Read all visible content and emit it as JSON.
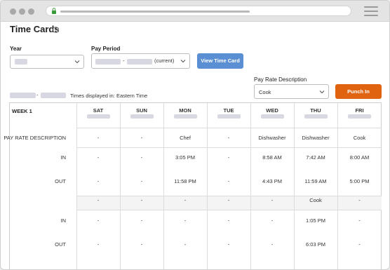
{
  "page": {
    "title": "Time Cards"
  },
  "filters": {
    "year_label": "Year",
    "pay_period_label": "Pay Period",
    "pay_period_sep": "-",
    "pay_period_suffix": "(current)",
    "view_button": "View Time Card",
    "pay_rate_label": "Pay Rate Description",
    "pay_rate_value": "Cook",
    "punch_button": "Punch In",
    "range_sep": "-",
    "timezone_text": "Times displayed in: Eastern Time"
  },
  "table": {
    "week_label": "WEEK 1",
    "days": [
      "SAT",
      "SUN",
      "MON",
      "TUE",
      "WED",
      "THU",
      "FRI"
    ],
    "row_labels": [
      "PAY RATE DESCRIPTION",
      "IN",
      "OUT",
      "",
      "IN",
      "OUT"
    ],
    "rows": [
      [
        "-",
        "-",
        "Chef",
        "-",
        "Dishwasher",
        "Dishwasher",
        "Cook"
      ],
      [
        "-",
        "-",
        "3:05 PM",
        "-",
        "8:58 AM",
        "7:42 AM",
        "8:00 AM"
      ],
      [
        "-",
        "-",
        "11:58 PM",
        "-",
        "4:43 PM",
        "11:59 AM",
        "5:00 PM"
      ],
      [
        "-",
        "-",
        "-",
        "-",
        "-",
        "Cook",
        "-"
      ],
      [
        "-",
        "-",
        "-",
        "-",
        "-",
        "1:05 PM",
        "-"
      ],
      [
        "-",
        "-",
        "-",
        "-",
        "-",
        "6:03 PM",
        "-"
      ]
    ]
  },
  "colors": {
    "primary_button": "#5b8fd3",
    "punch_button": "#e0630f"
  },
  "icons": [
    "lock-icon",
    "menu-icon",
    "help-icon",
    "chevron-down-icon"
  ]
}
